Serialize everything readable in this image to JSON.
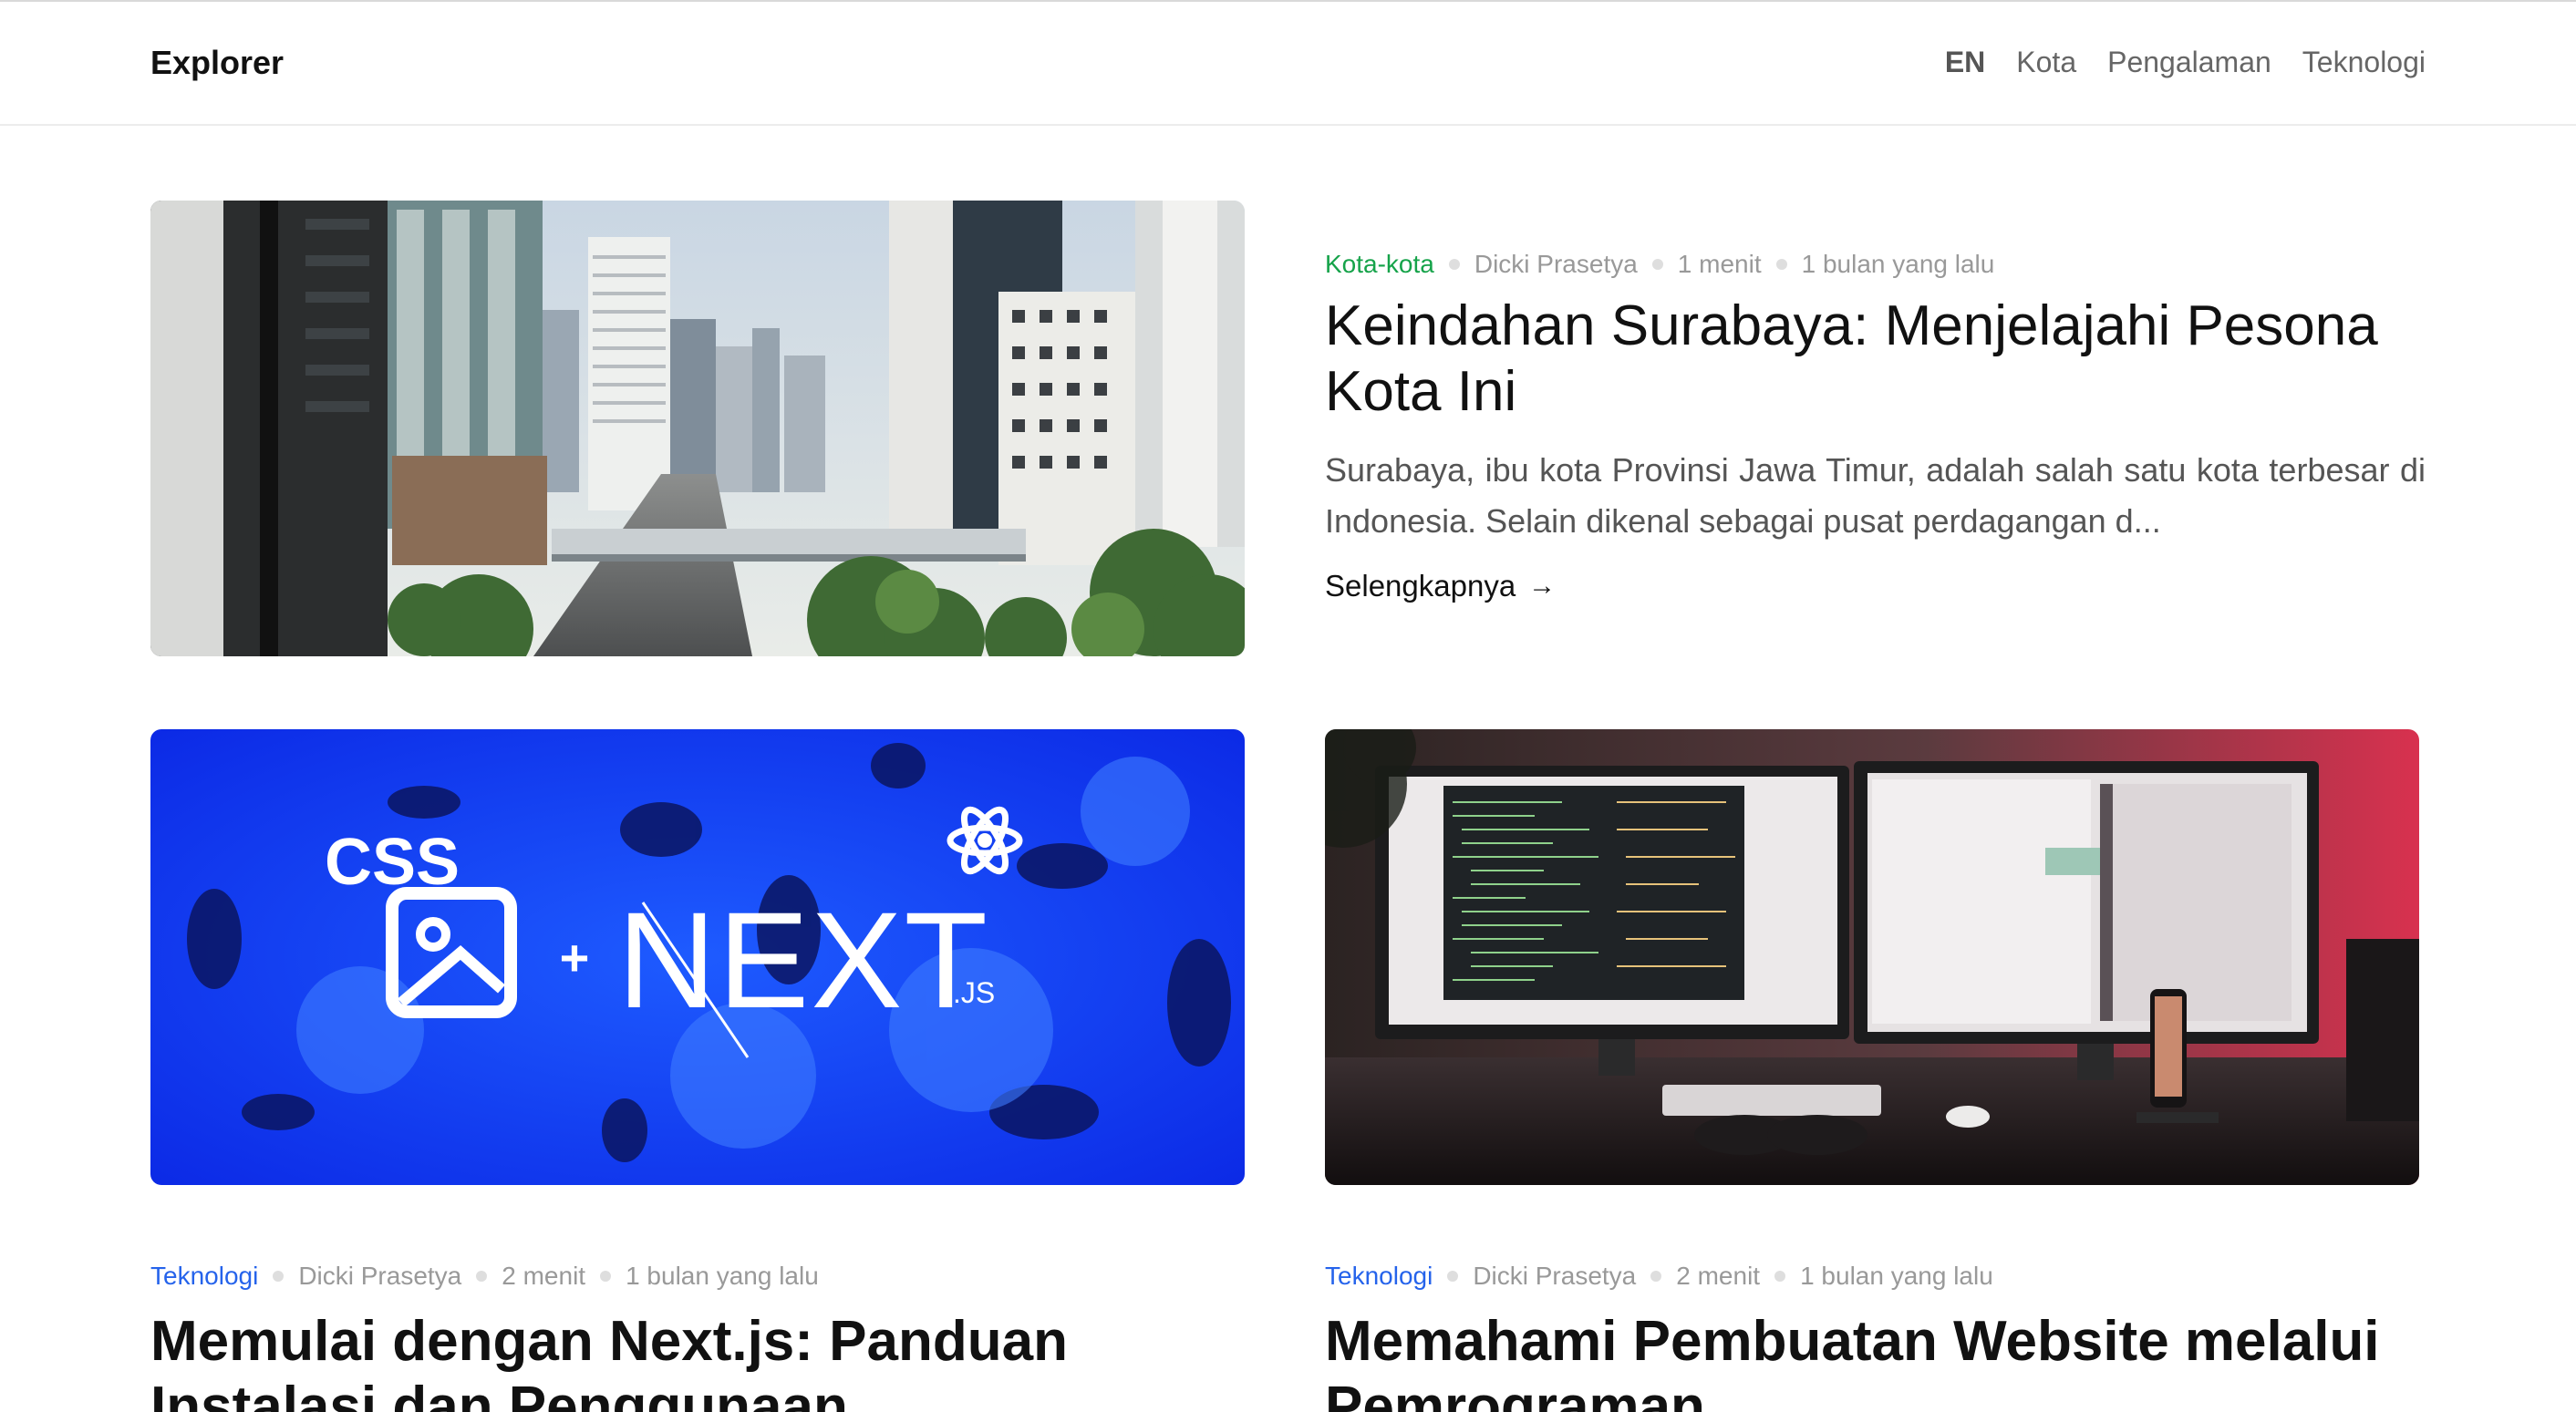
{
  "header": {
    "brand": "Explorer",
    "lang": "EN",
    "nav": [
      "Kota",
      "Pengalaman",
      "Teknologi"
    ]
  },
  "hero": {
    "category": "Kota-kota",
    "author": "Dicki Prasetya",
    "read_time": "1 menit",
    "date": "1 bulan yang lalu",
    "title": "Keindahan Surabaya: Menjelajahi Pesona Kota Ini",
    "excerpt": "Surabaya, ibu kota Provinsi Jawa Timur, adalah salah satu kota terbesar di Indonesia. Selain dikenal sebagai pusat perdagangan d...",
    "read_more": "Selengkapnya",
    "image": "city-skyline-photo"
  },
  "cards": [
    {
      "category": "Teknologi",
      "author": "Dicki Prasetya",
      "read_time": "2 menit",
      "date": "1 bulan yang lalu",
      "title": "Memulai dengan Next.js: Panduan Instalasi dan Penggunaan",
      "image": "css-nextjs-banner",
      "banner": {
        "css": "CSS",
        "plus": "+",
        "next": "NEXT",
        "js": ".JS"
      }
    },
    {
      "category": "Teknologi",
      "author": "Dicki Prasetya",
      "read_time": "2 menit",
      "date": "1 bulan yang lalu",
      "title": "Memahami Pembuatan Website melalui Pemrograman",
      "image": "dual-monitor-desk-photo"
    }
  ],
  "colors": {
    "category_green": "#16a34a",
    "category_blue": "#2563eb",
    "banner_blue": "#1f3df0"
  }
}
